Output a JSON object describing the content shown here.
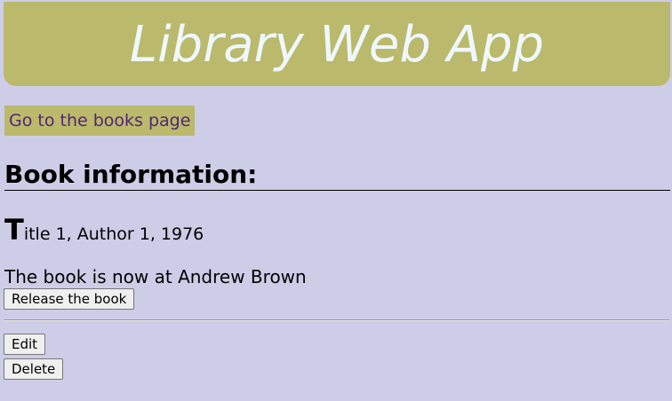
{
  "header": {
    "title": "Library Web App"
  },
  "nav": {
    "books_link": "Go to the books page"
  },
  "section": {
    "heading": "Book information:"
  },
  "book": {
    "first_letter": "T",
    "rest": "itle 1, Author 1, 1976"
  },
  "status": {
    "text": "The book is now at Andrew Brown"
  },
  "actions": {
    "release_label": "Release the book",
    "edit_label": "Edit",
    "delete_label": "Delete"
  },
  "colors": {
    "background": "#cecde8",
    "header_bg": "#bbb96b",
    "header_text": "#eef8ff",
    "link_text": "#52257a"
  }
}
